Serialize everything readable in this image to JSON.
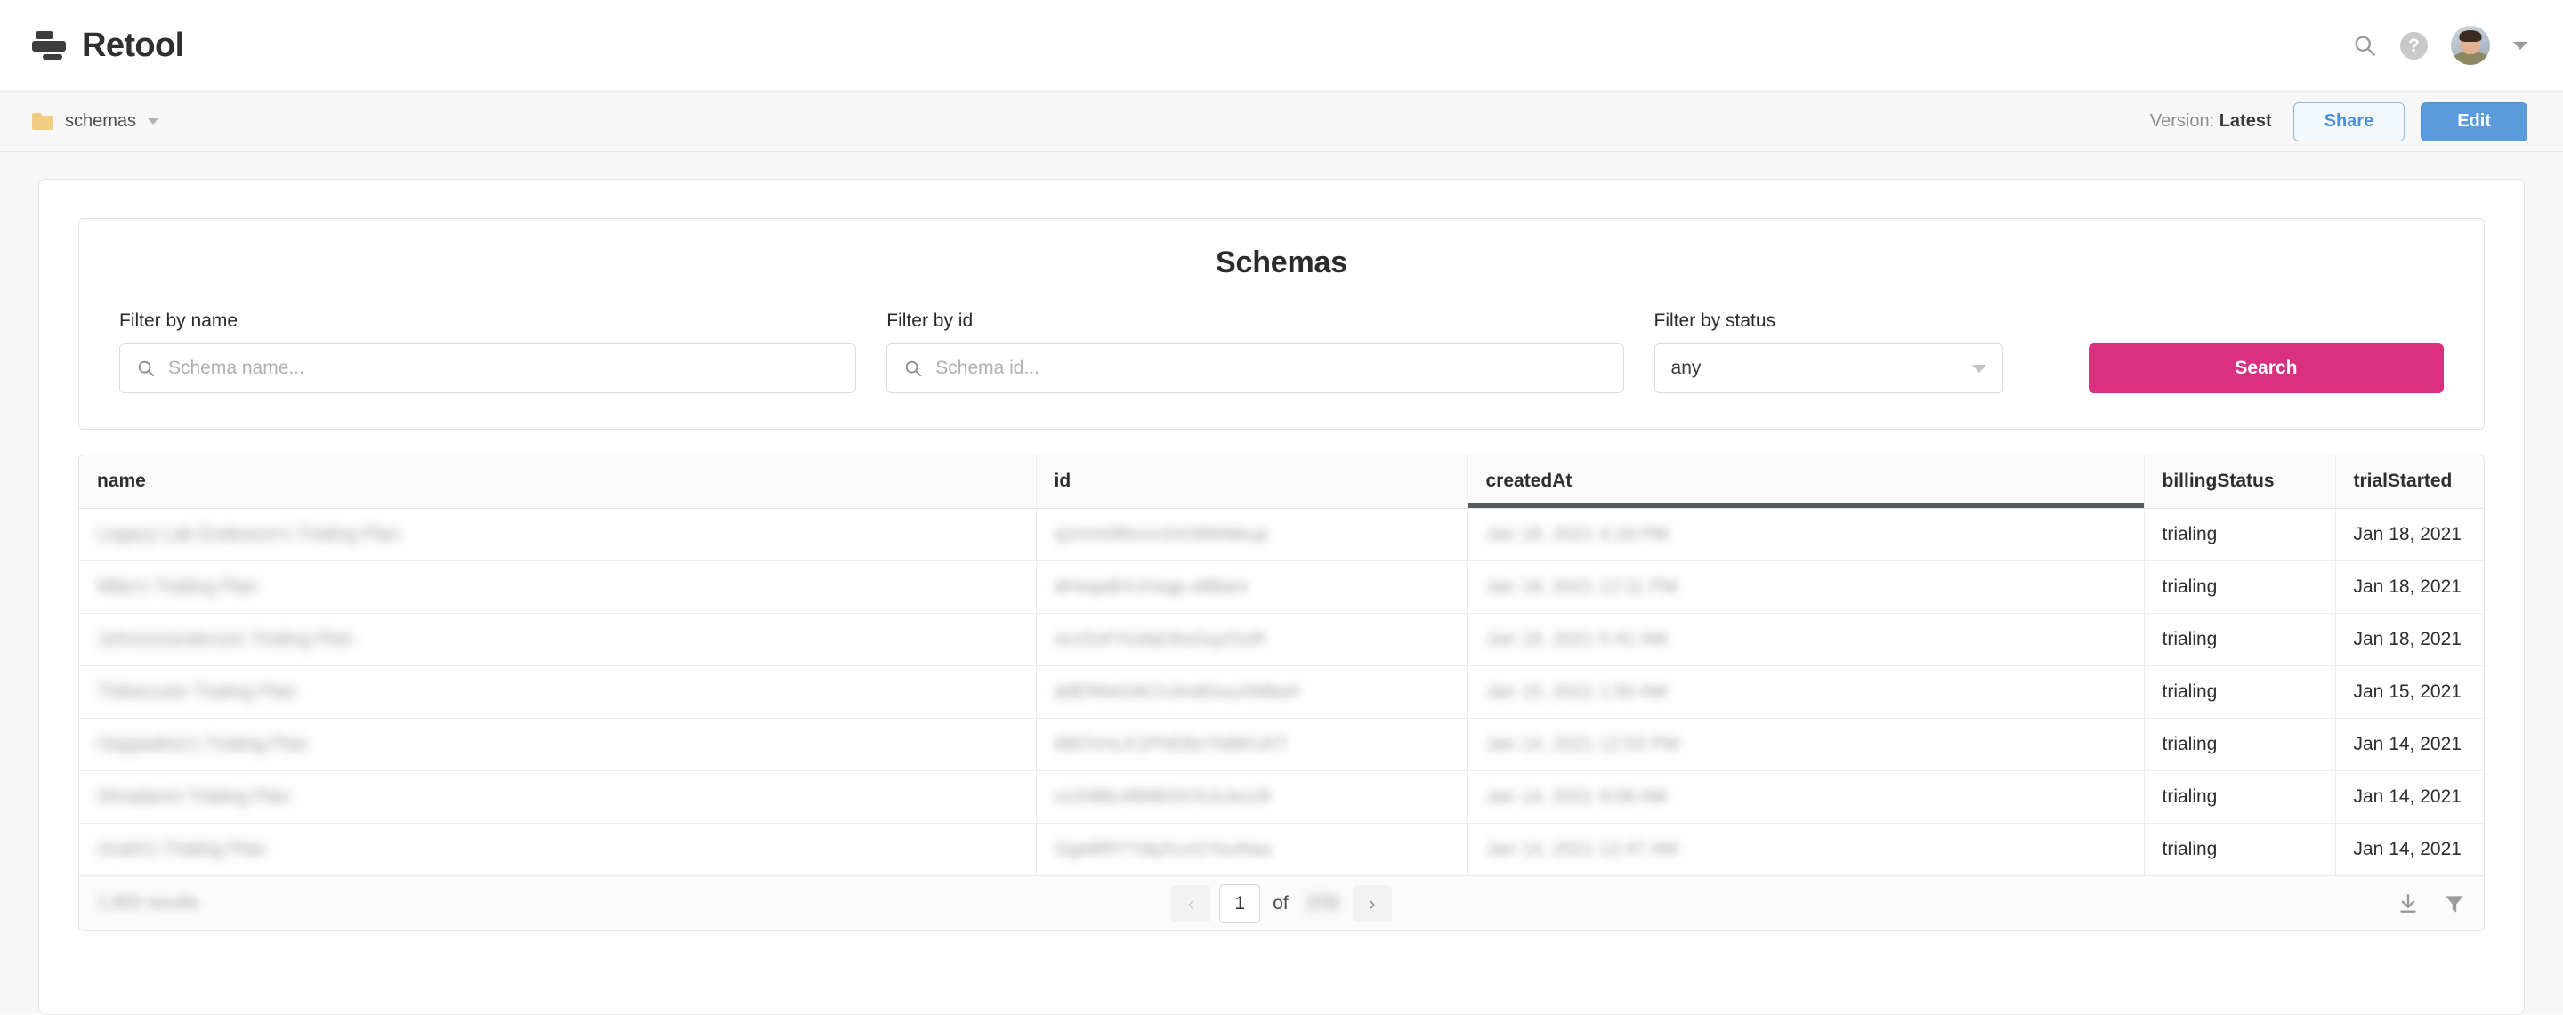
{
  "topnav": {
    "brand_name": "Retool",
    "icons": {
      "search": "search-icon",
      "help": "?",
      "avatar": "user-avatar",
      "caret": "chevron-down-icon"
    }
  },
  "subheader": {
    "breadcrumb_label": "schemas",
    "version_prefix": "Version: ",
    "version_value": "Latest",
    "share_label": "Share",
    "edit_label": "Edit",
    "colors": {
      "share_text": "#4a90d9",
      "edit_bg": "#5a9bdc"
    }
  },
  "panel": {
    "title": "Schemas",
    "filters": [
      {
        "label": "Filter by name",
        "placeholder": "Schema name...",
        "value": "",
        "type": "search"
      },
      {
        "label": "Filter by id",
        "placeholder": "Schema id...",
        "value": "",
        "type": "search"
      },
      {
        "label": "Filter by status",
        "value": "any",
        "type": "select",
        "options": [
          "any"
        ]
      }
    ],
    "search_button": "Search",
    "search_button_color": "#d9317f"
  },
  "table": {
    "columns": [
      "name",
      "id",
      "createdAt",
      "billingStatus",
      "trialStarted"
    ],
    "active_column": "createdAt",
    "rows": [
      {
        "name": "",
        "id": "",
        "createdAt": "",
        "billingStatus": "trialing",
        "trialStarted": "Jan 18, 2021"
      },
      {
        "name": "",
        "id": "",
        "createdAt": "",
        "billingStatus": "trialing",
        "trialStarted": "Jan 18, 2021"
      },
      {
        "name": "",
        "id": "",
        "createdAt": "",
        "billingStatus": "trialing",
        "trialStarted": "Jan 18, 2021"
      },
      {
        "name": "",
        "id": "",
        "createdAt": "",
        "billingStatus": "trialing",
        "trialStarted": "Jan 15, 2021"
      },
      {
        "name": "",
        "id": "",
        "createdAt": "",
        "billingStatus": "trialing",
        "trialStarted": "Jan 14, 2021"
      },
      {
        "name": "",
        "id": "",
        "createdAt": "",
        "billingStatus": "trialing",
        "trialStarted": "Jan 14, 2021"
      },
      {
        "name": "",
        "id": "",
        "createdAt": "",
        "billingStatus": "trialing",
        "trialStarted": "Jan 14, 2021"
      }
    ],
    "footer": {
      "results_count": "",
      "prev_label": "‹",
      "next_label": "›",
      "page_value": "1",
      "of_label": "of",
      "total_pages": "",
      "download_icon": "download-icon",
      "filter_icon": "funnel-icon"
    }
  }
}
